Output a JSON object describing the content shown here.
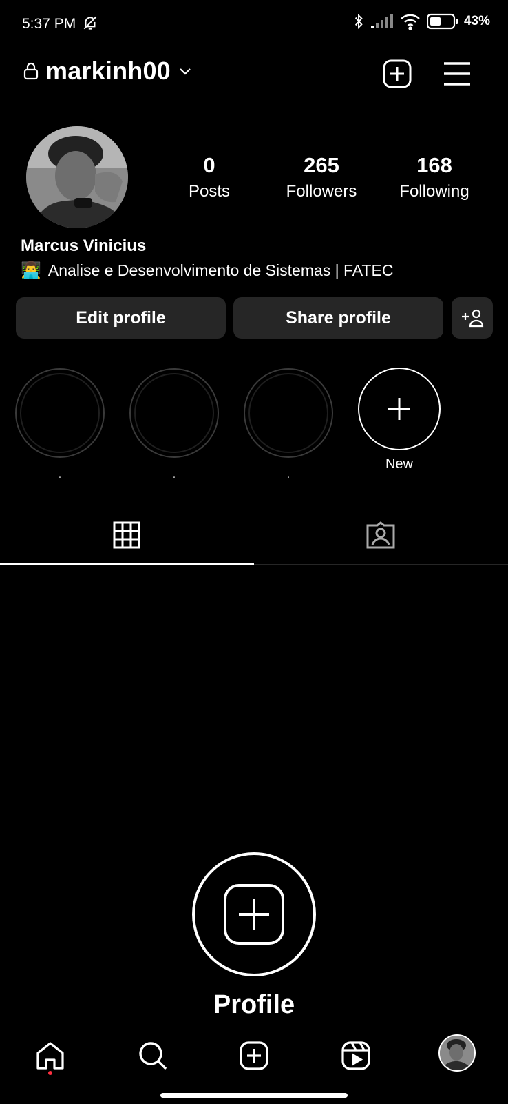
{
  "status_bar": {
    "time": "5:37 PM",
    "battery": "43%"
  },
  "header": {
    "username": "markinh00"
  },
  "profile": {
    "posts": "0",
    "posts_label": "Posts",
    "followers": "265",
    "followers_label": "Followers",
    "following": "168",
    "following_label": "Following",
    "full_name": "Marcus Vinicius",
    "bio_emoji": "👨‍💻",
    "bio": "Analise e Desenvolvimento de Sistemas | FATEC"
  },
  "buttons": {
    "edit": "Edit profile",
    "share": "Share profile"
  },
  "highlights": {
    "items": [
      {
        "label": "."
      },
      {
        "label": "."
      },
      {
        "label": "."
      }
    ],
    "new_label": "New"
  },
  "tabs": [
    {
      "icon": "grid-icon",
      "active": true
    },
    {
      "icon": "tagged-icon",
      "active": false
    }
  ],
  "empty_state": {
    "title": "Profile"
  },
  "nav": {
    "items": [
      "home-icon",
      "search-icon",
      "create-icon",
      "reels-icon",
      "profile-avatar"
    ]
  }
}
